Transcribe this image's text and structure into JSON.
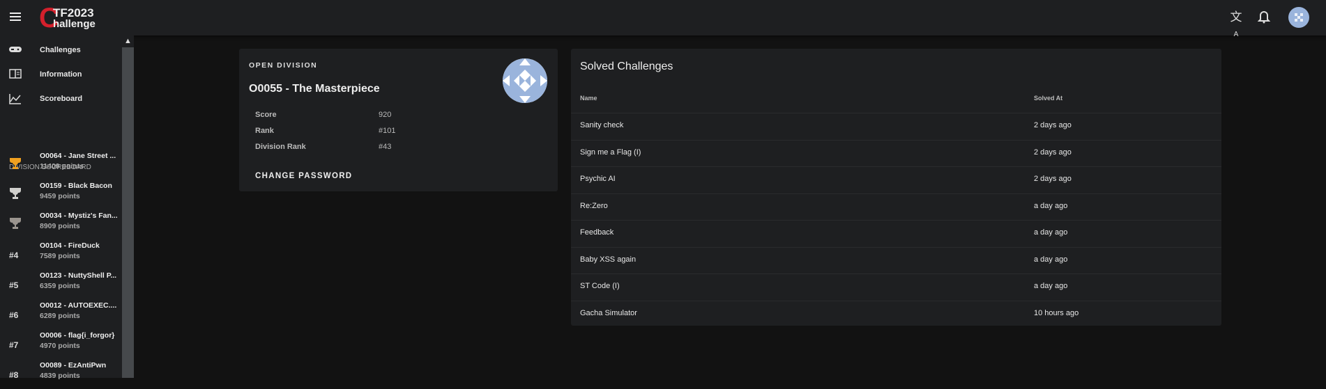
{
  "header": {
    "logo_text": [
      "C",
      "TF2023",
      "hallenge"
    ],
    "icons": [
      "menu-icon",
      "translate-icon",
      "bell-icon",
      "user-avatar"
    ]
  },
  "sidebar": {
    "nav": [
      {
        "label": "Challenges",
        "icon": "gamepad-icon"
      },
      {
        "label": "Information",
        "icon": "book-icon"
      },
      {
        "label": "Scoreboard",
        "icon": "chart-icon"
      }
    ],
    "division_label": "DIVISION SCOREBOARD",
    "entries": [
      {
        "rank": "#1",
        "name": "O0064 - Jane Street ...",
        "points": "11409 points",
        "trophy": "#f0a020"
      },
      {
        "rank": "#2",
        "name": "O0159 - Black Bacon",
        "points": "9459 points",
        "trophy": "#d0cfcc"
      },
      {
        "rank": "#3",
        "name": "O0034 - Mystiz's Fan...",
        "points": "8909 points",
        "trophy": "#9a948e"
      },
      {
        "rank": "#4",
        "name": "O0104 - FireDuck",
        "points": "7589 points"
      },
      {
        "rank": "#5",
        "name": "O0123 - NuttyShell P...",
        "points": "6359 points"
      },
      {
        "rank": "#6",
        "name": "O0012 - AUTOEXEC....",
        "points": "6289 points"
      },
      {
        "rank": "#7",
        "name": "O0006 - flag{i_forgor}",
        "points": "4970 points"
      },
      {
        "rank": "#8",
        "name": "O0089 - EzAntiPwn",
        "points": "4839 points"
      }
    ]
  },
  "team": {
    "division": "OPEN DIVISION",
    "name": "O0055 - The Masterpiece",
    "stats": [
      {
        "label": "Score",
        "value": "920"
      },
      {
        "label": "Rank",
        "value": "#101"
      },
      {
        "label": "Division Rank",
        "value": "#43"
      }
    ],
    "change_password": "CHANGE PASSWORD"
  },
  "solved": {
    "title": "Solved Challenges",
    "columns": [
      "Name",
      "Solved At"
    ],
    "rows": [
      {
        "name": "Sanity check",
        "at": "2 days ago"
      },
      {
        "name": "Sign me a Flag (I)",
        "at": "2 days ago"
      },
      {
        "name": "Psychic AI",
        "at": "2 days ago"
      },
      {
        "name": "Re:Zero",
        "at": "a day ago"
      },
      {
        "name": "Feedback",
        "at": "a day ago"
      },
      {
        "name": "Baby XSS again",
        "at": "a day ago"
      },
      {
        "name": "ST Code (I)",
        "at": "a day ago"
      },
      {
        "name": "Gacha Simulator",
        "at": "10 hours ago"
      }
    ]
  }
}
